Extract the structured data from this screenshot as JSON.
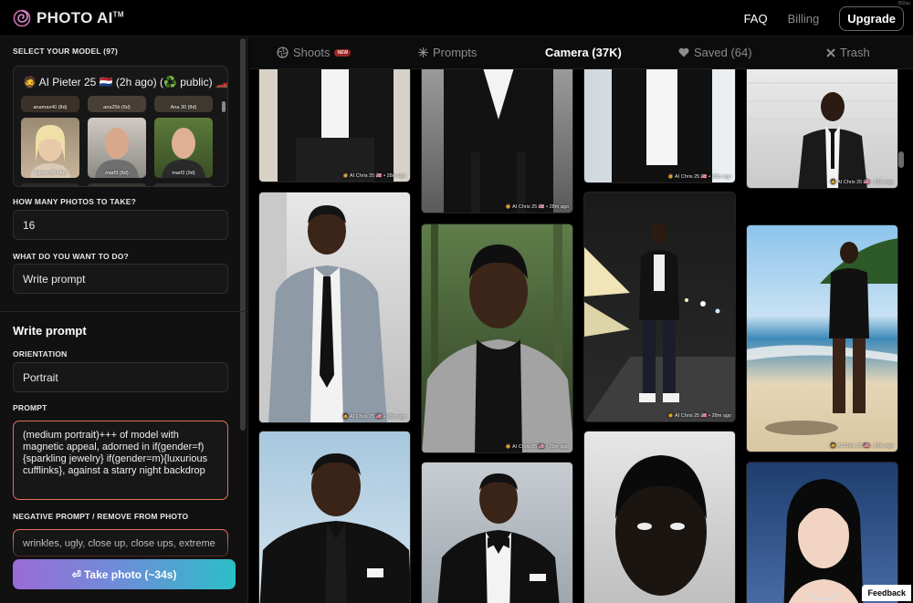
{
  "app": {
    "name": "PHOTO AI",
    "trademark": "TM",
    "corner_text": "352au"
  },
  "nav": {
    "faq": "FAQ",
    "billing": "Billing",
    "upgrade": "Upgrade"
  },
  "sidebar": {
    "model_label": "SELECT YOUR MODEL (97)",
    "selected_model": "🧔 AI Pieter 25 🇳🇱 (2h ago) (♻️ public) 🏎️",
    "model_thumbs": [
      {
        "label": "anamax40 (8d)"
      },
      {
        "label": "ana25b (6d)"
      },
      {
        "label": "Ana 30 (8d)"
      },
      {
        "label": "Sanne 25 (4d)"
      },
      {
        "label": "marf3 (8d)"
      },
      {
        "label": "marf2 (9d)"
      }
    ],
    "photos_label": "HOW MANY PHOTOS TO TAKE?",
    "photos_value": "16",
    "action_label": "WHAT DO YOU WANT TO DO?",
    "action_value": "Write prompt",
    "section_heading": "Write prompt",
    "orientation_label": "ORIENTATION",
    "orientation_value": "Portrait",
    "prompt_label": "PROMPT",
    "prompt_value": "(medium portrait)+++ of model with magnetic appeal, adorned in if(gender=f){sparkling jewelry} if(gender=m){luxurious cufflinks}, against a starry night backdrop",
    "negative_label": "NEGATIVE PROMPT / REMOVE FROM PHOTO",
    "negative_value": "wrinkles, ugly, close up, close ups, extreme",
    "take_photo": "⏎ Take photo (~34s)"
  },
  "tabs": [
    {
      "label": "Shoots",
      "badge": "NEW",
      "icon": "aperture-icon"
    },
    {
      "label": "Prompts",
      "icon": "sparkle-icon"
    },
    {
      "label": "Camera (37K)",
      "active": true
    },
    {
      "label": "Saved (64)",
      "icon": "heart-icon"
    },
    {
      "label": "Trash",
      "icon": "x-icon"
    }
  ],
  "gallery": {
    "meta": "🧔 AI Chris 25 🇺🇸 • 28m ago",
    "feedback": "Feedback"
  },
  "colors": {
    "accent_border": "#e0725d",
    "button_gradient_start": "#9b6bd6",
    "button_gradient_end": "#2bbfc6",
    "badge": "#9b2626"
  }
}
